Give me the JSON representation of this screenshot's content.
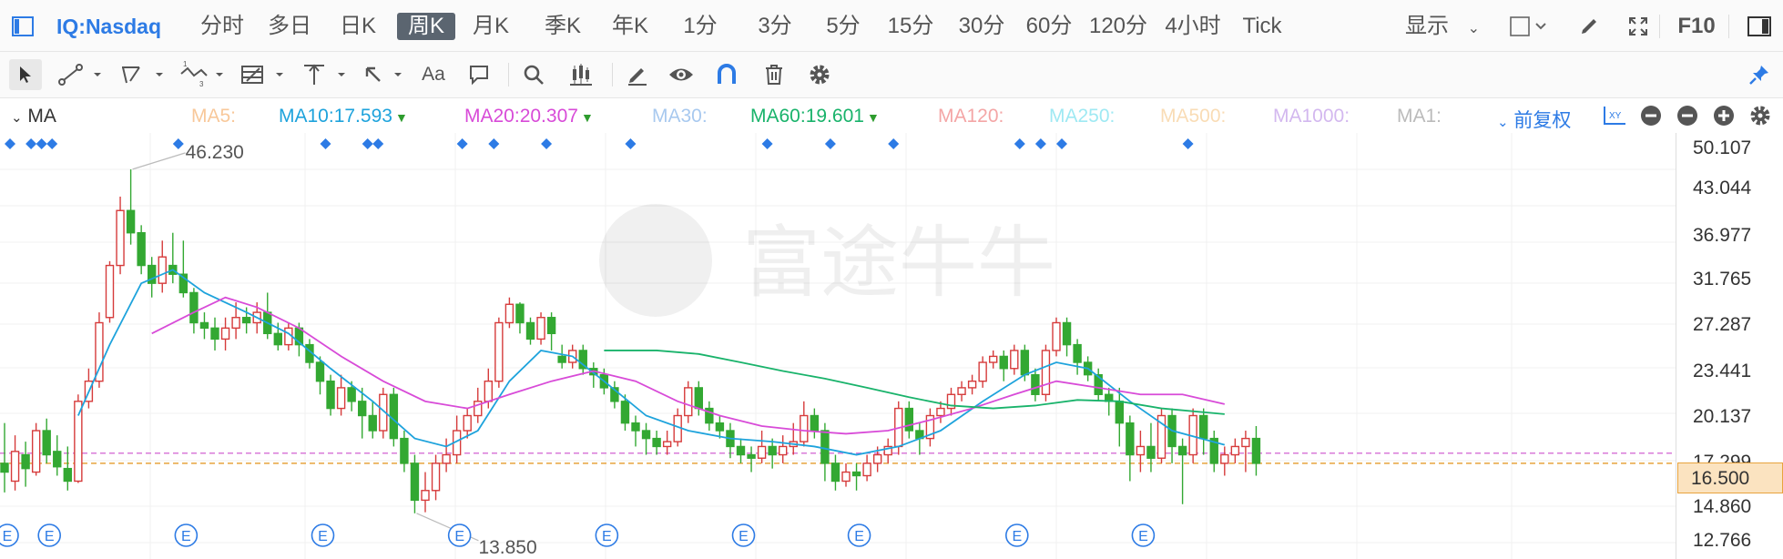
{
  "header": {
    "symbol": "IQ:Nasdaq",
    "timeframes": [
      "分时",
      "多日",
      "日K",
      "周K",
      "月K",
      "季K",
      "年K",
      "1分",
      "3分",
      "5分",
      "15分",
      "30分",
      "60分",
      "120分",
      "4小时",
      "Tick"
    ],
    "active_timeframe": "周K",
    "display_label": "显示",
    "f10_label": "F10"
  },
  "toolbar": {
    "text_tool": "Aa",
    "icons": [
      "cursor-icon",
      "line-icon",
      "polyline-icon",
      "wave-icon",
      "fib-icon",
      "vertical-icon",
      "arrow-icon",
      "text-icon",
      "comment-icon",
      "search-icon",
      "candle-icon",
      "pen-icon",
      "eye-icon",
      "magnet-icon",
      "trash-icon",
      "gear-icon",
      "pin-icon"
    ]
  },
  "ma_legend": {
    "title": "MA",
    "items": [
      {
        "label": "MA5:",
        "value": "",
        "color": "#f8c89a"
      },
      {
        "label": "MA10:",
        "value": "17.593",
        "color": "#1ea3dc",
        "arrow": "▼",
        "arrow_color": "#2e9c2e"
      },
      {
        "label": "MA20:",
        "value": "20.307",
        "color": "#d84bd8",
        "arrow": "▼",
        "arrow_color": "#2e9c2e"
      },
      {
        "label": "MA30:",
        "value": "",
        "color": "#a8c9ef"
      },
      {
        "label": "MA60:",
        "value": "19.601",
        "color": "#19b36b",
        "arrow": "▼",
        "arrow_color": "#2e9c2e"
      },
      {
        "label": "MA120:",
        "value": "",
        "color": "#f4a6a6"
      },
      {
        "label": "MA250:",
        "value": "",
        "color": "#9fe9f3"
      },
      {
        "label": "MA500:",
        "value": "",
        "color": "#f9dcb5"
      },
      {
        "label": "MA1000:",
        "value": "",
        "color": "#d3b8ef"
      },
      {
        "label": "MA1:",
        "value": "",
        "color": "#bbbbbb"
      }
    ],
    "adjust_label": "前复权"
  },
  "y_axis": {
    "ticks": [
      "50.107",
      "43.044",
      "36.977",
      "31.765",
      "27.287",
      "23.441",
      "20.137",
      "17.299",
      "14.860",
      "12.766"
    ],
    "current_price": "16.500",
    "scale": "log"
  },
  "annotations": {
    "high_label": "46.230",
    "low_label": "13.850",
    "event_marker": "E",
    "watermark": "富途牛牛"
  },
  "colors": {
    "up": "#d63b3b",
    "down": "#33a832",
    "ma10": "#1ea3dc",
    "ma20": "#d84bd8",
    "ma60": "#19b36b",
    "price_line": "#e8a33d",
    "ref_line": "#d97bd9",
    "dividend_marker": "#2d7be5",
    "accent": "#2d7be5"
  },
  "chart_data": {
    "type": "candlestick",
    "title": "IQ:Nasdaq",
    "y_scale": "log",
    "ylim": [
      11.8,
      52.5
    ],
    "candles": [
      [
        16.5,
        16.0,
        19.0,
        14.9
      ],
      [
        15.5,
        17.2,
        18.2,
        15.0
      ],
      [
        17.0,
        16.2,
        17.8,
        15.2
      ],
      [
        16.0,
        18.5,
        19.0,
        15.8
      ],
      [
        18.5,
        17.0,
        19.3,
        16.5
      ],
      [
        17.2,
        16.3,
        18.2,
        15.8
      ],
      [
        16.2,
        15.5,
        17.5,
        15.0
      ],
      [
        15.5,
        20.5,
        21.0,
        15.4
      ],
      [
        20.5,
        22.0,
        23.0,
        20.0
      ],
      [
        22.0,
        27.0,
        28.0,
        21.5
      ],
      [
        27.5,
        33.0,
        33.5,
        27.0
      ],
      [
        33.0,
        40.0,
        42.0,
        32.0
      ],
      [
        40.0,
        37.0,
        46.2,
        35.5
      ],
      [
        37.0,
        33.0,
        38.0,
        32.0
      ],
      [
        33.0,
        31.0,
        34.0,
        29.5
      ],
      [
        31.0,
        34.0,
        36.0,
        30.0
      ],
      [
        33.0,
        32.0,
        37.0,
        31.0
      ],
      [
        32.0,
        30.0,
        36.0,
        29.5
      ],
      [
        30.0,
        27.0,
        30.5,
        26.0
      ],
      [
        27.0,
        26.5,
        28.0,
        25.5
      ],
      [
        26.5,
        25.5,
        27.5,
        24.5
      ],
      [
        25.5,
        26.5,
        27.5,
        24.5
      ],
      [
        26.5,
        27.5,
        29.0,
        25.5
      ],
      [
        27.5,
        27.0,
        28.5,
        26.0
      ],
      [
        27.0,
        28.0,
        29.0,
        26.0
      ],
      [
        28.0,
        26.0,
        30.0,
        25.5
      ],
      [
        26.0,
        25.0,
        27.0,
        24.5
      ],
      [
        25.0,
        26.5,
        27.0,
        24.5
      ],
      [
        26.5,
        25.0,
        27.0,
        24.0
      ],
      [
        25.0,
        23.5,
        25.5,
        23.0
      ],
      [
        23.5,
        22.0,
        24.0,
        21.0
      ],
      [
        22.0,
        20.0,
        22.5,
        19.5
      ],
      [
        20.0,
        21.5,
        22.5,
        19.5
      ],
      [
        21.5,
        20.5,
        22.0,
        19.8
      ],
      [
        20.5,
        19.5,
        21.5,
        18.0
      ],
      [
        19.5,
        18.5,
        20.5,
        18.0
      ],
      [
        18.5,
        21.0,
        21.5,
        18.0
      ],
      [
        21.0,
        18.0,
        21.5,
        17.5
      ],
      [
        18.0,
        16.5,
        18.5,
        16.0
      ],
      [
        16.5,
        14.5,
        17.0,
        13.85
      ],
      [
        14.5,
        15.0,
        16.0,
        13.9
      ],
      [
        15.0,
        16.5,
        17.0,
        14.5
      ],
      [
        16.5,
        17.0,
        18.0,
        16.0
      ],
      [
        17.0,
        18.5,
        19.5,
        16.5
      ],
      [
        18.5,
        19.5,
        20.0,
        18.0
      ],
      [
        19.5,
        20.5,
        21.5,
        19.0
      ],
      [
        20.5,
        22.0,
        23.0,
        20.0
      ],
      [
        22.0,
        27.0,
        27.5,
        21.5
      ],
      [
        27.0,
        28.8,
        29.5,
        26.5
      ],
      [
        28.8,
        27.0,
        29.0,
        26.0
      ],
      [
        27.0,
        25.5,
        27.5,
        25.0
      ],
      [
        25.5,
        27.5,
        28.0,
        25.0
      ],
      [
        27.5,
        26.0,
        28.0,
        24.5
      ],
      [
        24.0,
        23.5,
        25.0,
        23.0
      ],
      [
        23.5,
        24.5,
        25.0,
        23.0
      ],
      [
        24.5,
        23.0,
        25.0,
        22.5
      ],
      [
        23.0,
        22.5,
        23.5,
        21.5
      ],
      [
        22.5,
        21.5,
        23.0,
        21.0
      ],
      [
        21.5,
        20.5,
        22.0,
        20.0
      ],
      [
        20.5,
        19.0,
        21.0,
        18.5
      ],
      [
        19.0,
        18.5,
        19.5,
        17.5
      ],
      [
        18.5,
        18.0,
        19.0,
        17.0
      ],
      [
        18.0,
        17.5,
        18.5,
        17.0
      ],
      [
        17.5,
        17.8,
        18.5,
        17.0
      ],
      [
        17.8,
        19.5,
        20.0,
        17.5
      ],
      [
        19.5,
        21.5,
        22.0,
        19.0
      ],
      [
        21.5,
        20.0,
        22.0,
        19.5
      ],
      [
        20.0,
        19.0,
        20.5,
        18.5
      ],
      [
        19.0,
        18.5,
        19.5,
        18.0
      ],
      [
        18.5,
        17.5,
        19.0,
        16.8
      ],
      [
        17.5,
        17.0,
        18.0,
        16.5
      ],
      [
        17.0,
        16.8,
        17.5,
        16.0
      ],
      [
        16.8,
        17.5,
        18.5,
        16.5
      ],
      [
        17.5,
        17.0,
        18.0,
        16.2
      ],
      [
        17.0,
        17.5,
        18.2,
        16.5
      ],
      [
        17.5,
        17.8,
        19.0,
        17.0
      ],
      [
        17.8,
        19.5,
        20.5,
        17.5
      ],
      [
        19.5,
        18.5,
        20.0,
        18.0
      ],
      [
        18.5,
        16.5,
        19.0,
        15.5
      ],
      [
        16.5,
        15.5,
        17.0,
        15.0
      ],
      [
        15.5,
        16.0,
        16.5,
        15.2
      ],
      [
        16.0,
        15.8,
        16.5,
        15.0
      ],
      [
        15.8,
        16.5,
        17.0,
        15.5
      ],
      [
        16.5,
        17.0,
        17.5,
        16.0
      ],
      [
        17.0,
        17.5,
        18.0,
        16.5
      ],
      [
        17.5,
        20.0,
        20.5,
        17.0
      ],
      [
        20.0,
        18.5,
        20.5,
        18.0
      ],
      [
        18.5,
        18.0,
        19.0,
        17.0
      ],
      [
        18.0,
        19.5,
        20.0,
        17.5
      ],
      [
        19.5,
        20.0,
        20.5,
        19.0
      ],
      [
        20.0,
        21.0,
        21.5,
        19.5
      ],
      [
        21.0,
        21.5,
        22.0,
        20.5
      ],
      [
        21.5,
        22.0,
        22.5,
        21.0
      ],
      [
        22.0,
        23.5,
        24.0,
        21.5
      ],
      [
        23.5,
        24.0,
        24.5,
        23.0
      ],
      [
        24.0,
        23.0,
        24.5,
        22.0
      ],
      [
        23.0,
        24.5,
        25.0,
        22.5
      ],
      [
        24.5,
        22.5,
        25.0,
        22.0
      ],
      [
        22.5,
        21.0,
        23.0,
        20.5
      ],
      [
        21.0,
        24.5,
        25.0,
        20.5
      ],
      [
        24.5,
        27.0,
        27.5,
        24.0
      ],
      [
        27.0,
        25.0,
        27.5,
        24.0
      ],
      [
        25.0,
        23.5,
        25.5,
        22.5
      ],
      [
        23.5,
        22.5,
        24.0,
        22.0
      ],
      [
        22.5,
        21.0,
        23.0,
        20.5
      ],
      [
        21.0,
        20.5,
        21.5,
        19.5
      ],
      [
        20.5,
        19.0,
        21.5,
        17.5
      ],
      [
        19.0,
        17.0,
        19.5,
        15.5
      ],
      [
        17.0,
        17.5,
        18.5,
        16.0
      ],
      [
        17.5,
        16.8,
        19.0,
        16.0
      ],
      [
        16.8,
        19.5,
        20.0,
        16.5
      ],
      [
        19.5,
        17.5,
        20.0,
        16.5
      ],
      [
        17.5,
        17.0,
        18.0,
        14.3
      ],
      [
        17.0,
        19.5,
        20.0,
        16.5
      ],
      [
        19.5,
        18.0,
        20.0,
        17.0
      ],
      [
        18.0,
        16.5,
        18.5,
        16.0
      ],
      [
        16.5,
        17.0,
        17.5,
        15.8
      ],
      [
        17.0,
        17.5,
        18.0,
        16.5
      ],
      [
        17.5,
        18.0,
        18.5,
        16.0
      ],
      [
        18.0,
        16.5,
        18.8,
        15.8
      ]
    ],
    "ma": [
      {
        "name": "MA10",
        "color": "#1ea3dc",
        "points": [
          [
            7,
            19.5
          ],
          [
            10,
            25.0
          ],
          [
            13,
            31.0
          ],
          [
            16,
            32.5
          ],
          [
            19,
            30.0
          ],
          [
            23,
            28.0
          ],
          [
            27,
            26.0
          ],
          [
            31,
            23.0
          ],
          [
            35,
            20.5
          ],
          [
            39,
            18.0
          ],
          [
            42,
            17.5
          ],
          [
            45,
            18.5
          ],
          [
            48,
            22.0
          ],
          [
            51,
            24.5
          ],
          [
            54,
            24.0
          ],
          [
            57,
            22.0
          ],
          [
            61,
            19.5
          ],
          [
            65,
            18.5
          ],
          [
            69,
            18.0
          ],
          [
            73,
            17.8
          ],
          [
            77,
            17.5
          ],
          [
            81,
            17.0
          ],
          [
            85,
            17.5
          ],
          [
            89,
            18.5
          ],
          [
            93,
            20.5
          ],
          [
            97,
            22.5
          ],
          [
            100,
            23.5
          ],
          [
            103,
            23.0
          ],
          [
            107,
            20.5
          ],
          [
            111,
            18.5
          ],
          [
            116,
            17.6
          ]
        ]
      },
      {
        "name": "MA20",
        "color": "#d84bd8",
        "points": [
          [
            14,
            26.0
          ],
          [
            18,
            28.0
          ],
          [
            21,
            29.5
          ],
          [
            24,
            28.5
          ],
          [
            28,
            26.5
          ],
          [
            32,
            24.0
          ],
          [
            36,
            22.0
          ],
          [
            40,
            20.5
          ],
          [
            44,
            20.0
          ],
          [
            48,
            21.0
          ],
          [
            52,
            22.0
          ],
          [
            56,
            22.8
          ],
          [
            60,
            22.0
          ],
          [
            64,
            20.5
          ],
          [
            68,
            19.5
          ],
          [
            72,
            18.8
          ],
          [
            76,
            18.5
          ],
          [
            80,
            18.3
          ],
          [
            84,
            18.5
          ],
          [
            88,
            19.2
          ],
          [
            92,
            20.0
          ],
          [
            96,
            21.0
          ],
          [
            100,
            22.0
          ],
          [
            104,
            21.5
          ],
          [
            108,
            21.0
          ],
          [
            112,
            21.0
          ],
          [
            116,
            20.3
          ]
        ]
      },
      {
        "name": "MA60",
        "color": "#19b36b",
        "points": [
          [
            57,
            24.5
          ],
          [
            62,
            24.5
          ],
          [
            66,
            24.2
          ],
          [
            70,
            23.5
          ],
          [
            74,
            22.8
          ],
          [
            78,
            22.2
          ],
          [
            82,
            21.5
          ],
          [
            86,
            20.8
          ],
          [
            90,
            20.2
          ],
          [
            94,
            20.0
          ],
          [
            98,
            20.2
          ],
          [
            102,
            20.6
          ],
          [
            106,
            20.5
          ],
          [
            110,
            20.0
          ],
          [
            116,
            19.6
          ]
        ]
      }
    ],
    "current_price": 16.5,
    "reference_line": 17.1,
    "high": {
      "index": 12,
      "value": 46.23
    },
    "low": {
      "index": 39,
      "value": 13.85
    },
    "dividend_markers": [
      0,
      2,
      3,
      4,
      16,
      30,
      34,
      35,
      43,
      46,
      51,
      59,
      72,
      78,
      84,
      96,
      98,
      100,
      112
    ],
    "earnings_markers": [
      0,
      4,
      17,
      30,
      43,
      57,
      70,
      81,
      96,
      108
    ]
  }
}
